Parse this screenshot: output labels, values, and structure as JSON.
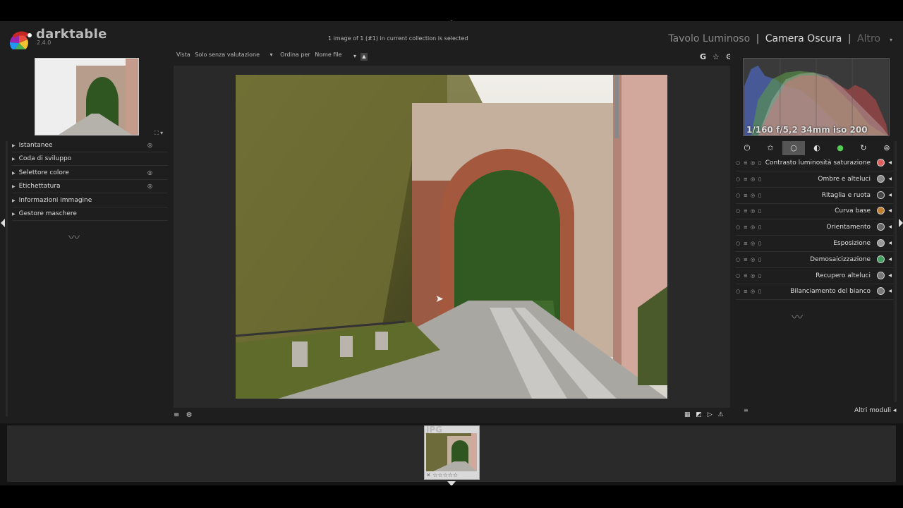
{
  "app": {
    "name": "darktable",
    "version": "2.4.0"
  },
  "status": "1 image of 1 (#1) in current collection is selected",
  "views": {
    "lighttable": "Tavolo Luminoso",
    "darkroom": "Camera Oscura",
    "other": "Altro",
    "separator": "|"
  },
  "toolbar": {
    "view_label": "Vista",
    "view_value": "Solo senza valutazione",
    "sort_label": "Ordina per",
    "sort_value": "Nome file",
    "right_icons": [
      "G",
      "☆",
      "⚙"
    ]
  },
  "left_modules": [
    {
      "label": "Istantanee",
      "reset": true
    },
    {
      "label": "Coda di sviluppo",
      "reset": false
    },
    {
      "label": "Selettore colore",
      "reset": true
    },
    {
      "label": "Etichettatura",
      "reset": true
    },
    {
      "label": "Informazioni immagine",
      "reset": false
    },
    {
      "label": "Gestore maschere",
      "reset": false
    }
  ],
  "histogram_info": "1/160 f/5,2 34mm iso 200",
  "module_group_icons": [
    "power-icon",
    "star-icon",
    "circle-icon",
    "half-circle-icon",
    "color-ball-icon",
    "rotate-icon",
    "aperture-icon"
  ],
  "right_modules": [
    {
      "label": "Contrasto luminosità saturazione",
      "icon_color": "#e06060"
    },
    {
      "label": "Ombre e alteluci",
      "icon_color": "#888888"
    },
    {
      "label": "Ritaglia e ruota",
      "icon_color": "#444444"
    },
    {
      "label": "Curva base",
      "icon_color": "#c08030"
    },
    {
      "label": "Orientamento",
      "icon_color": "#666666"
    },
    {
      "label": "Esposizione",
      "icon_color": "#999999"
    },
    {
      "label": "Demosaicizzazione",
      "icon_color": "#40a060"
    },
    {
      "label": "Recupero alteluci",
      "icon_color": "#777777"
    },
    {
      "label": "Bilanciamento del bianco",
      "icon_color": "#777777"
    }
  ],
  "more_modules": "Altri moduli",
  "filmstrip": {
    "label": "JPG",
    "stars": "✕ ☆☆☆☆☆"
  },
  "bottom_toolbar": {
    "left_icons": [
      "≡",
      "⚙"
    ],
    "right_icons": [
      "▦",
      "◩",
      "▷",
      "⚠"
    ]
  }
}
